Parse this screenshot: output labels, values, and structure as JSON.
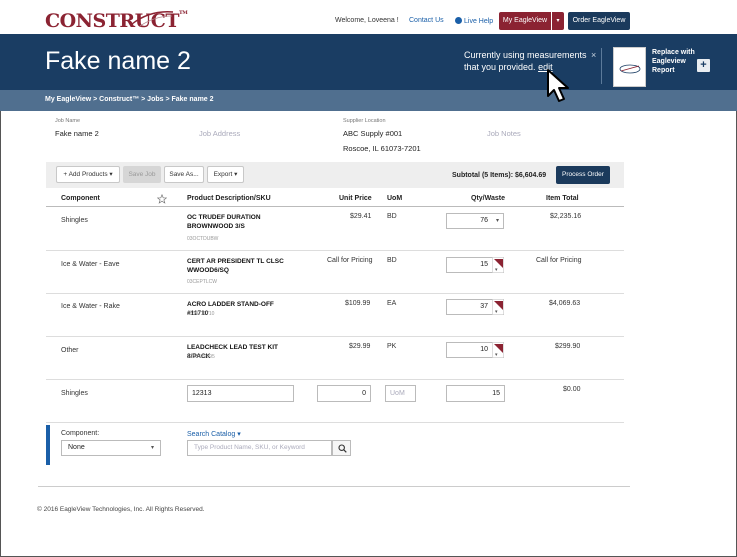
{
  "app": {
    "logo": "CONSTRUCT",
    "logo_tm": "TM"
  },
  "topnav": {
    "welcome": "Welcome, Loveena !",
    "contact": "Contact Us",
    "help": "Live Help",
    "my_eagleview": "My EagleView",
    "caret": "▾",
    "order": "Order EagleView"
  },
  "header": {
    "title": "Fake name 2",
    "notice_line1": "Currently using measurements",
    "notice_line2": "that you provided.",
    "notice_edit": "edit",
    "close": "×",
    "replace_label": "Replace with Eagleview Report",
    "plus": "+",
    "thumb_label": "EagleView"
  },
  "breadcrumb": "My EagleView >  Construct™ >  Jobs  >  Fake name 2",
  "job": {
    "name_label": "Job Name",
    "name": "Fake name 2",
    "address_placeholder": "Job Address",
    "supplier_label": "Supplier Location",
    "supplier_name": "ABC Supply #001",
    "supplier_city": "Roscoe, IL 61073-7201",
    "notes_placeholder": "Job Notes"
  },
  "toolbar": {
    "add_products": "+ Add Products ▾",
    "save_job": "Save Job",
    "save_as": "Save As...",
    "export": "Export ▾",
    "subtotal": "Subtotal (5 Items): $6,604.69",
    "process_order": "Process Order"
  },
  "table": {
    "headers": {
      "component": "Component",
      "description": "Product Description/SKU",
      "unit_price": "Unit Price",
      "uom": "UoM",
      "qty": "Qty/Waste",
      "total": "Item Total"
    },
    "rows": [
      {
        "component": "Shingles",
        "desc": "OC TRUDEF DURATION BROWNWOOD 3/S",
        "sku": "03OCTDUBW",
        "price": "$29.41",
        "uom": "BD",
        "qty": "76",
        "total": "$2,235.16"
      },
      {
        "component": "Ice & Water - Eave",
        "desc": "CERT AR PRESIDENT TL CLSC WWOOD6/SQ",
        "sku": "03CEPTLCW",
        "price": "Call for Pricing",
        "uom": "BD",
        "qty": "15",
        "total": "Call for Pricing"
      },
      {
        "component": "Ice & Water - Rake",
        "desc": "ACRO LADDER STAND-OFF #11710",
        "sku": "0339711710",
        "price": "$109.99",
        "uom": "EA",
        "qty": "37",
        "total": "$4,069.63"
      },
      {
        "component": "Other",
        "desc": "LEADCHECK LEAD TEST KIT 8/PACK",
        "sku": "1783420595",
        "price": "$29.99",
        "uom": "PK",
        "qty": "10",
        "total": "$299.90"
      }
    ],
    "new_row": {
      "component": "Shingles",
      "desc_value": "12313",
      "price_value": "0",
      "uom_placeholder": "UoM",
      "qty_value": "15",
      "total": "$0.00"
    }
  },
  "add_section": {
    "component_label": "Component:",
    "component_value": "None",
    "search_label": "Search Catalog ▾",
    "search_placeholder": "Type Product Name, SKU, or Keyword"
  },
  "footer": "© 2016 EagleView Technologies, Inc. All Rights Reserved."
}
